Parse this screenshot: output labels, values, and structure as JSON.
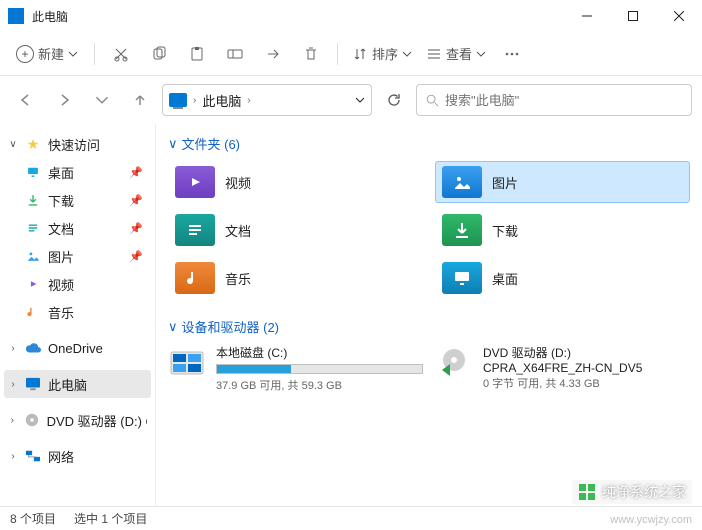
{
  "titlebar": {
    "title": "此电脑"
  },
  "toolbar": {
    "new_label": "新建",
    "sort_label": "排序",
    "view_label": "查看"
  },
  "address": {
    "location": "此电脑"
  },
  "search": {
    "placeholder": "搜索\"此电脑\""
  },
  "sidebar": {
    "quick": {
      "label": "快速访问",
      "items": [
        {
          "label": "桌面",
          "icon": "desktop",
          "pin": true
        },
        {
          "label": "下载",
          "icon": "download",
          "pin": true
        },
        {
          "label": "文档",
          "icon": "document",
          "pin": true
        },
        {
          "label": "图片",
          "icon": "pictures",
          "pin": true
        },
        {
          "label": "视频",
          "icon": "video",
          "pin": false
        },
        {
          "label": "音乐",
          "icon": "music",
          "pin": false
        }
      ]
    },
    "onedrive": "OneDrive",
    "thispc": "此电脑",
    "dvd": "DVD 驱动器 (D:) CP",
    "network": "网络"
  },
  "sections": {
    "folders_header": "文件夹 (6)",
    "drives_header": "设备和驱动器 (2)"
  },
  "folders": [
    {
      "label": "视频",
      "color": "violet",
      "glyph": "video"
    },
    {
      "label": "图片",
      "color": "blue",
      "glyph": "image",
      "selected": true
    },
    {
      "label": "文档",
      "color": "teal",
      "glyph": "doc"
    },
    {
      "label": "下载",
      "color": "green",
      "glyph": "down"
    },
    {
      "label": "音乐",
      "color": "orange",
      "glyph": "music"
    },
    {
      "label": "桌面",
      "color": "cyan",
      "glyph": "desk"
    }
  ],
  "drives": [
    {
      "title": "本地磁盘 (C:)",
      "sub": "37.9 GB 可用, 共 59.3 GB",
      "fill_pct": 36,
      "icon": "cdrive"
    },
    {
      "title": "DVD 驱动器 (D:)",
      "line2": "CPRA_X64FRE_ZH-CN_DV5",
      "sub": "0 字节 可用, 共 4.33 GB",
      "icon": "dvd"
    }
  ],
  "status": {
    "items": "8 个项目",
    "selected": "选中 1 个项目"
  },
  "watermark": {
    "text": "纯净系统之家",
    "url": "www.ycwjzy.com"
  }
}
